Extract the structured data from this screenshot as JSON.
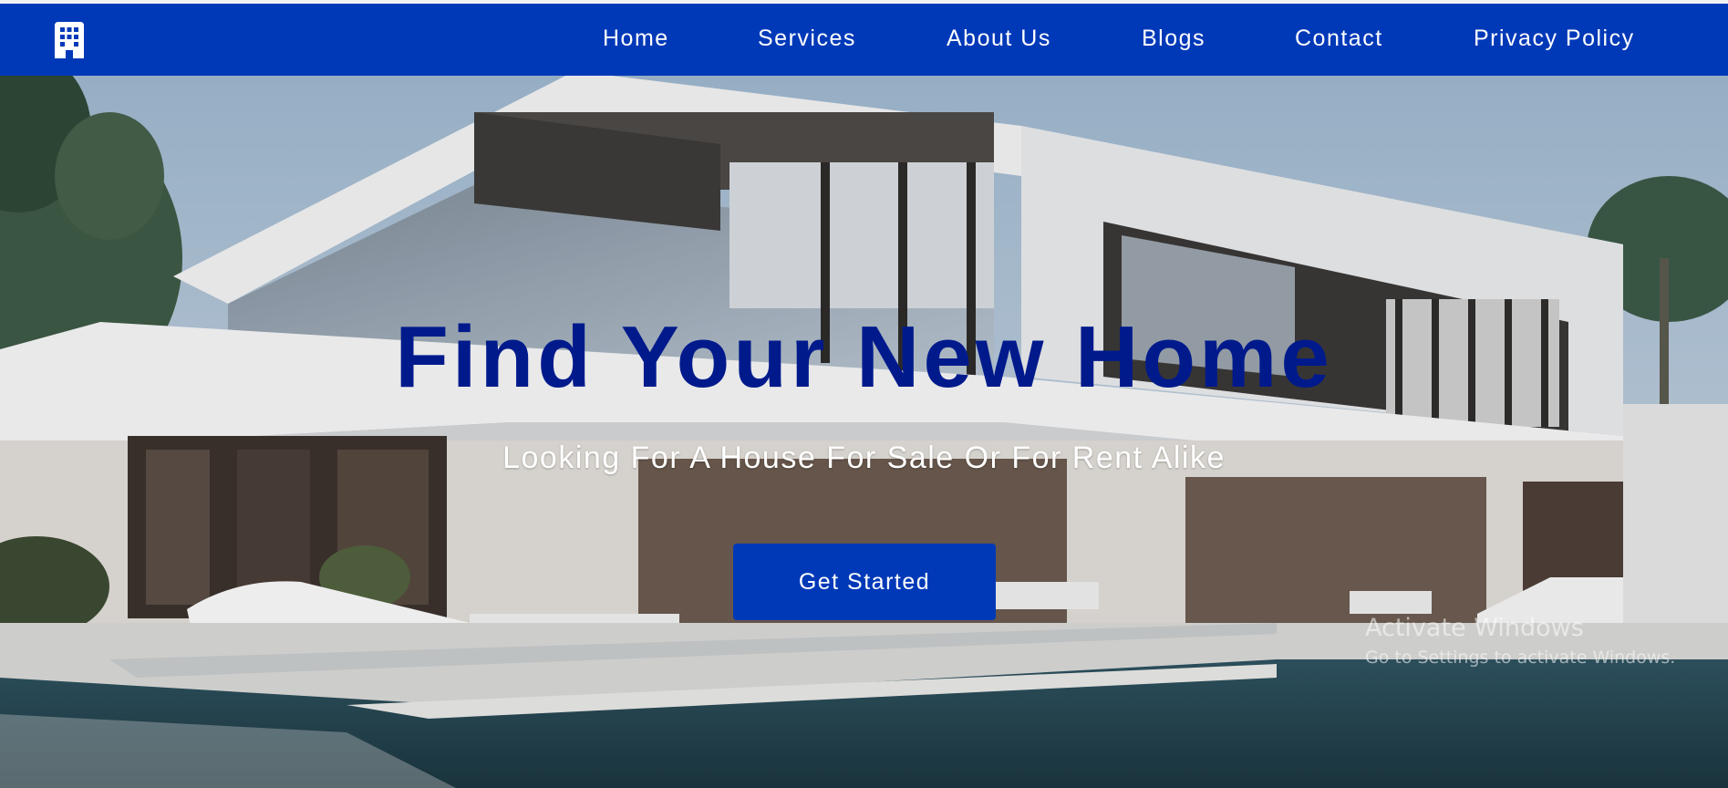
{
  "brand": {
    "logo_icon": "building-icon",
    "nav_color": "#0039b8",
    "title_color": "#001a8c"
  },
  "nav": {
    "items": [
      {
        "label": "Home"
      },
      {
        "label": "Services"
      },
      {
        "label": "About Us"
      },
      {
        "label": "Blogs"
      },
      {
        "label": "Contact"
      },
      {
        "label": "Privacy Policy"
      }
    ]
  },
  "hero": {
    "title": "Find Your New Home",
    "subtitle": "Looking For A House For Sale Or For Rent Alike",
    "cta_label": "Get Started",
    "background": "modern-white-villa-with-pool-photo"
  },
  "os_watermark": {
    "title": "Activate Windows",
    "subtitle": "Go to Settings to activate Windows."
  }
}
